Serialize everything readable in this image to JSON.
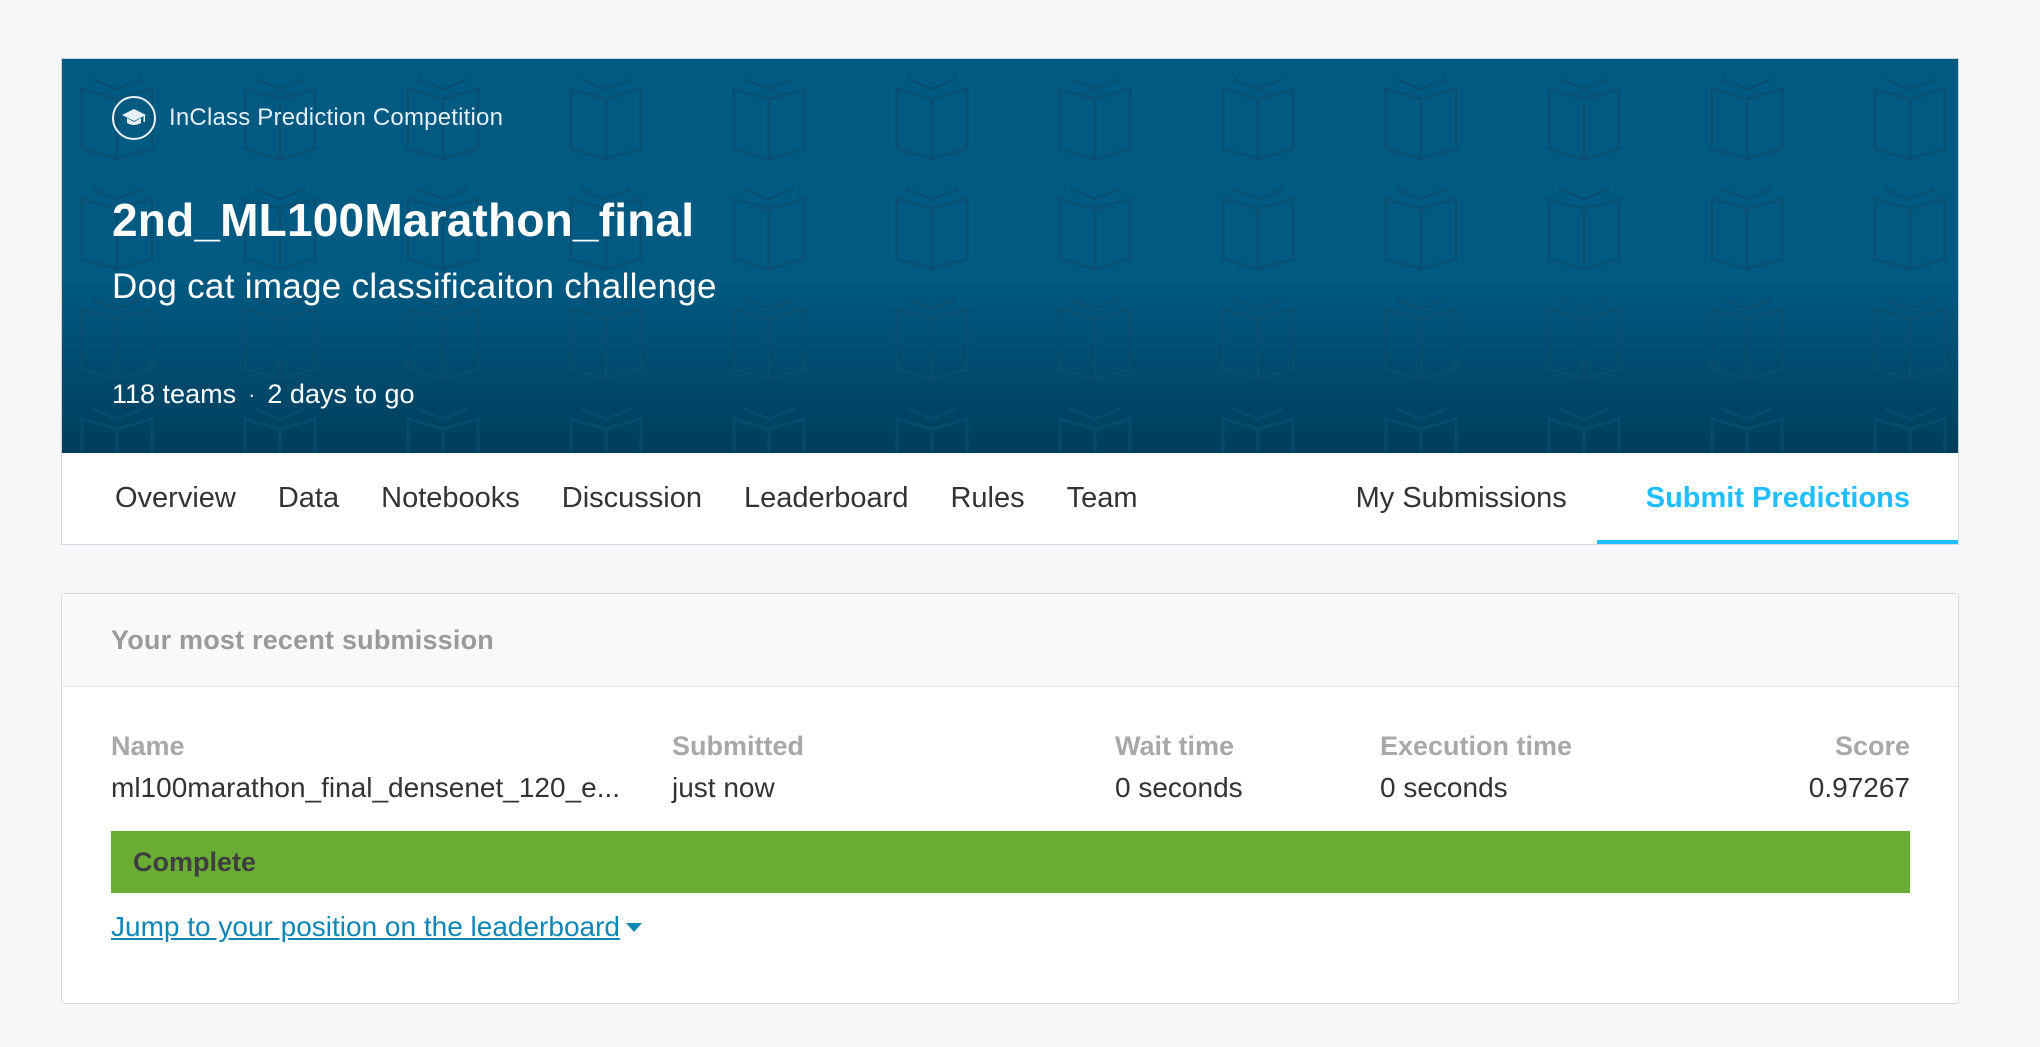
{
  "header": {
    "kind_label": "InClass Prediction Competition",
    "title": "2nd_ML100Marathon_final",
    "subtitle": "Dog cat image classificaiton challenge",
    "teams": "118 teams",
    "separator": "·",
    "deadline": "2 days to go",
    "kind_icon": "graduation-cap-icon",
    "background_color": "#005a82"
  },
  "tabs": {
    "left": [
      "Overview",
      "Data",
      "Notebooks",
      "Discussion",
      "Leaderboard",
      "Rules",
      "Team"
    ],
    "my_submissions": "My Submissions",
    "submit_predictions": "Submit Predictions",
    "active_color": "#20beff"
  },
  "submission": {
    "heading": "Your most recent submission",
    "columns": {
      "name": "Name",
      "submitted": "Submitted",
      "wait_time": "Wait time",
      "execution_time": "Execution time",
      "score": "Score"
    },
    "values": {
      "name": "ml100marathon_final_densenet_120_e...",
      "submitted": "just now",
      "wait_time": "0 seconds",
      "execution_time": "0 seconds",
      "score": "0.97267"
    },
    "status": "Complete",
    "status_color": "#6aad34",
    "jump_link": "Jump to your position on the leaderboard"
  }
}
